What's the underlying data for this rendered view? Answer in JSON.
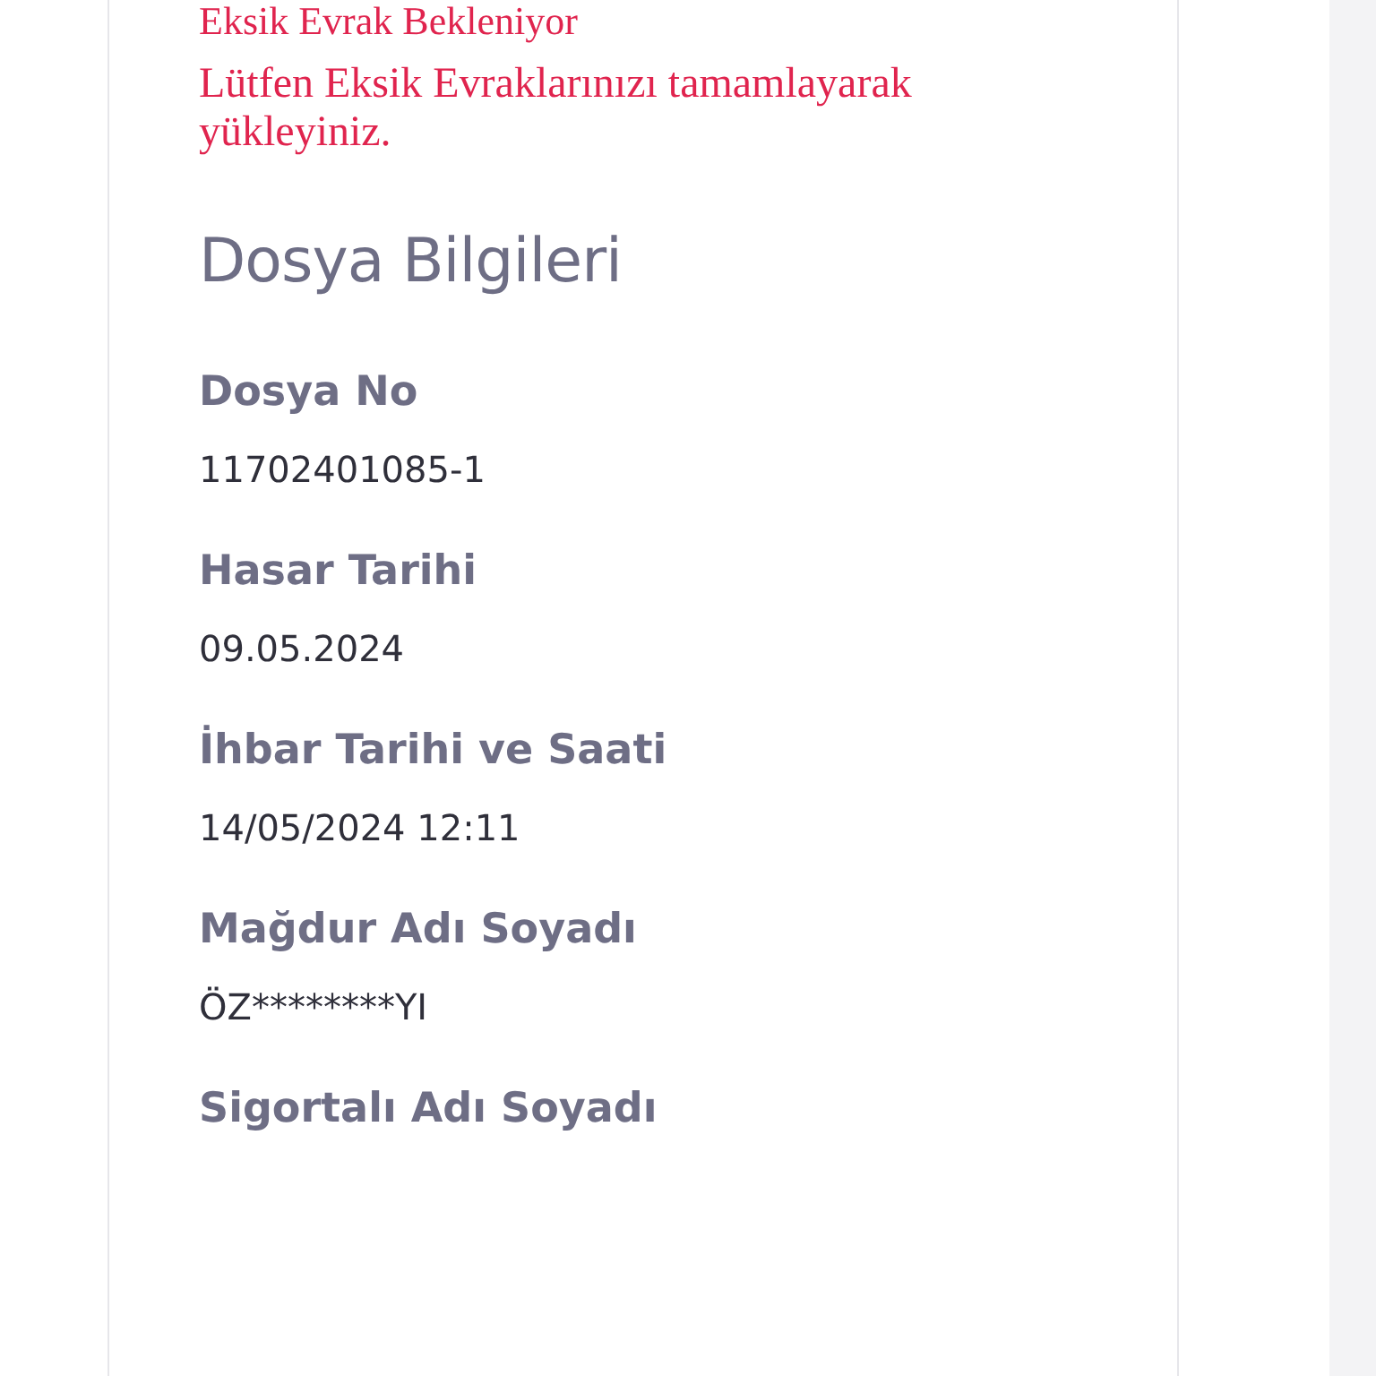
{
  "notice": {
    "status": "Eksik Evrak Bekleniyor",
    "message": "Lütfen Eksik Evraklarınızı tamamlayarak yükleyiniz."
  },
  "section": {
    "title": "Dosya Bilgileri",
    "fields": [
      {
        "label": "Dosya No",
        "value": "11702401085-1"
      },
      {
        "label": "Hasar Tarihi",
        "value": "09.05.2024"
      },
      {
        "label": "İhbar Tarihi ve Saati",
        "value": "14/05/2024 12:11"
      },
      {
        "label": "Mağdur Adı Soyadı",
        "value": "ÖZ********YI"
      },
      {
        "label": "Sigortalı Adı Soyadı"
      }
    ]
  }
}
